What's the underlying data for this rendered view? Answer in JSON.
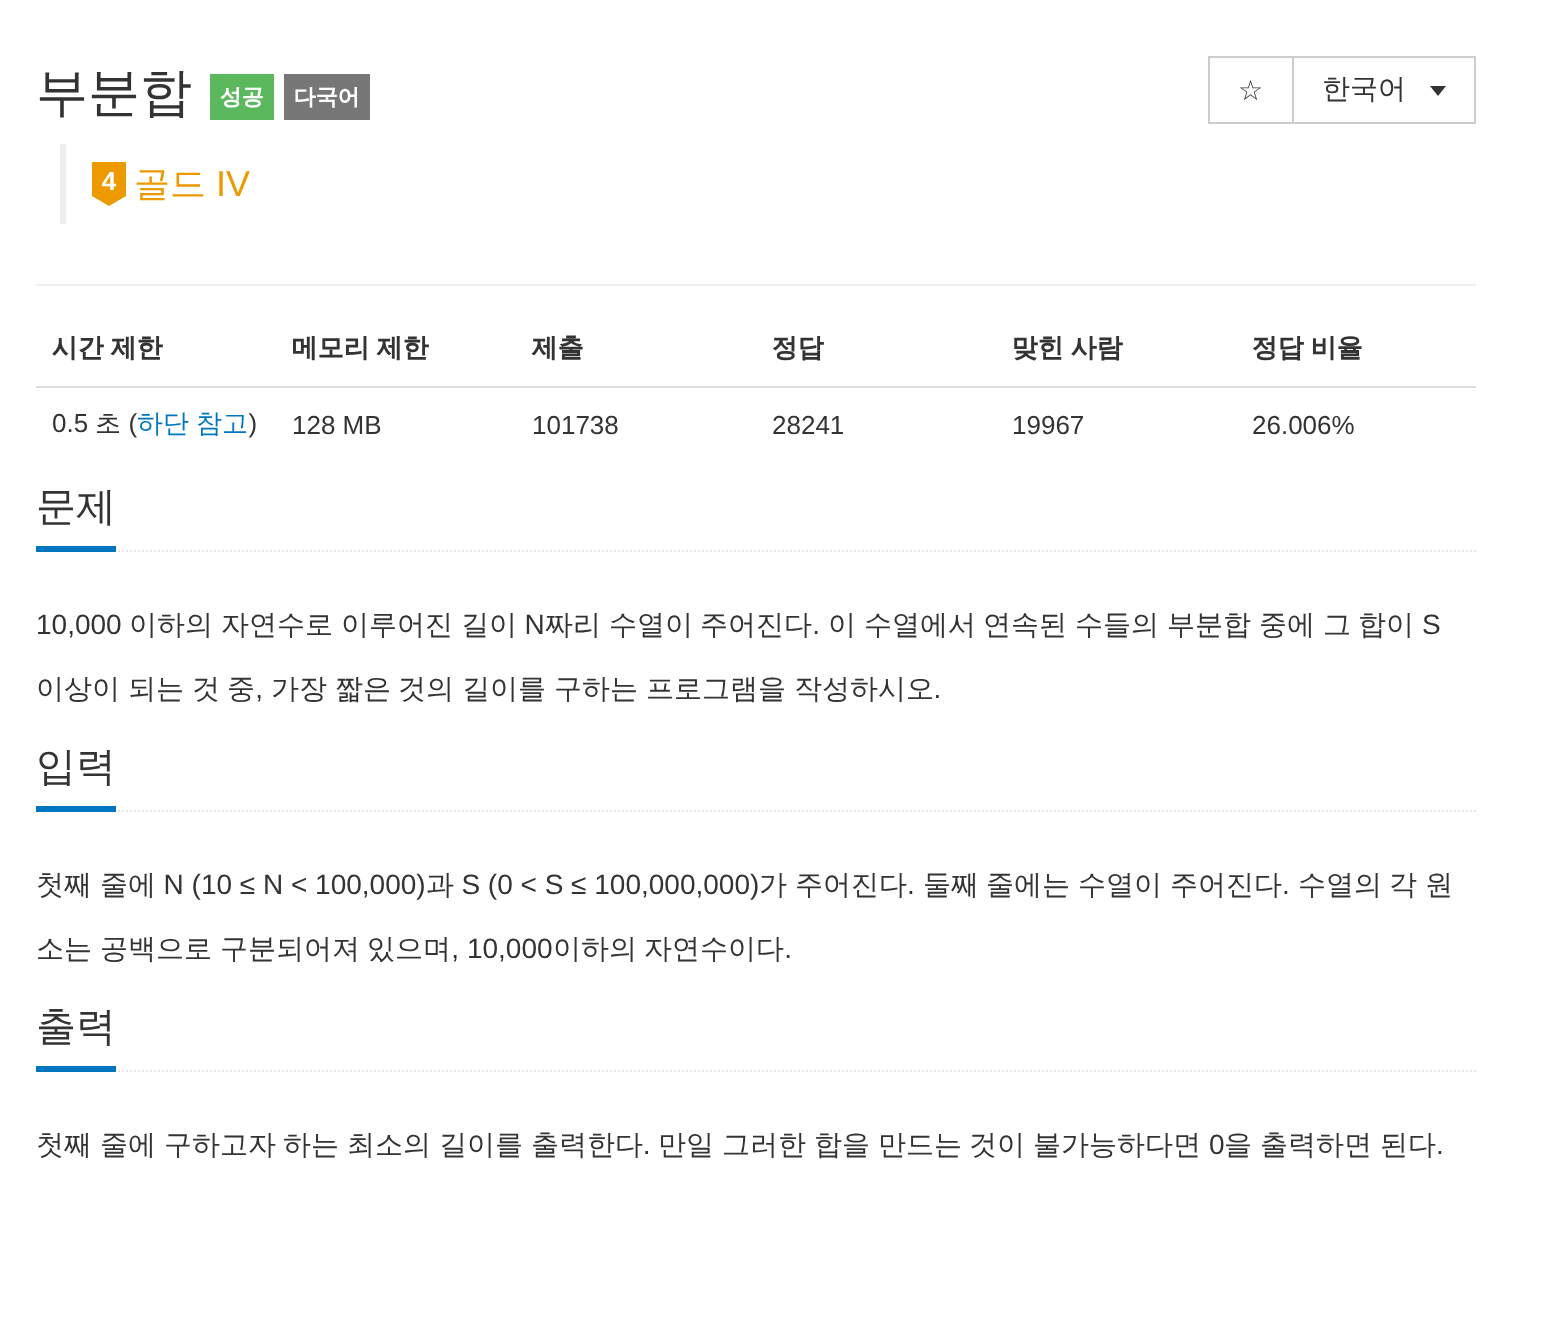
{
  "title": "부분합",
  "badges": [
    {
      "label": "성공",
      "kind": "success"
    },
    {
      "label": "다국어",
      "kind": "multi"
    }
  ],
  "star_button": {
    "label": "☆"
  },
  "language_select": {
    "value": "한국어"
  },
  "tier": {
    "number": "4",
    "label": "골드 IV"
  },
  "table": {
    "columns": [
      "시간 제한",
      "메모리 제한",
      "제출",
      "정답",
      "맞힌 사람",
      "정답 비율"
    ],
    "rows": [
      [
        {
          "text": "0.5 초 (",
          "link": "하단 참고",
          "after": ")"
        },
        {
          "text": "128 MB"
        },
        {
          "text": "101738"
        },
        {
          "text": "28241"
        },
        {
          "text": "19967"
        },
        {
          "text": "26.006%"
        }
      ]
    ]
  },
  "sections": [
    {
      "heading": "문제",
      "paragraph": "10,000 이하의 자연수로 이루어진 길이 N짜리 수열이 주어진다. 이 수열에서 연속된 수들의 부분합 중에 그 합이 S 이상이 되는 것 중, 가장 짧은 것의 길이를 구하는 프로그램을 작성하시오."
    },
    {
      "heading": "입력",
      "paragraph": "첫째 줄에 N (10 ≤ N < 100,000)과 S (0 < S ≤ 100,000,000)가 주어진다. 둘째 줄에는 수열이 주어진다. 수열의 각 원소는 공백으로 구분되어져 있으며, 10,000이하의 자연수이다."
    },
    {
      "heading": "출력",
      "paragraph": "첫째 줄에 구하고자 하는 최소의 길이를 출력한다. 만일 그러한 합을 만드는 것이 불가능하다면 0을 출력하면 된다."
    }
  ]
}
